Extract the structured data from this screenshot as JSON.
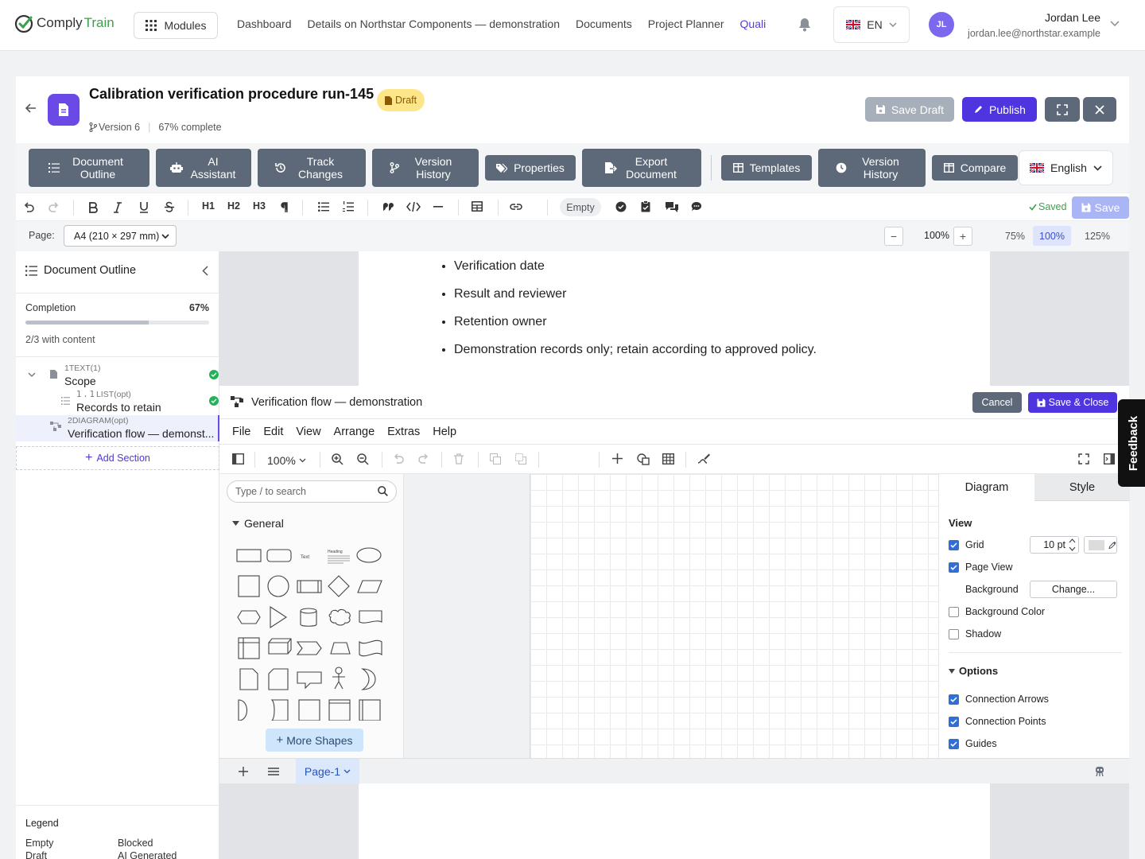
{
  "brand": {
    "part1": "Comply",
    "part2": "Train"
  },
  "nav": {
    "modules": "Modules",
    "links": [
      "Dashboard",
      "Details on Northstar Components — demonstration",
      "Documents",
      "Project Planner",
      "Quali"
    ],
    "lang": "EN",
    "user_initials": "JL",
    "user_name": "Jordan Lee",
    "user_email": "jordan.lee@northstar.example"
  },
  "doc": {
    "title": "Calibration verification procedure run-145",
    "status": "Draft",
    "version": "Version 6",
    "progress_text": "67% complete",
    "save_draft": "Save Draft",
    "publish": "Publish"
  },
  "toolbar": {
    "outline": "Document Outline",
    "ai": "AI Assistant",
    "track": "Track Changes",
    "vhist": "Version History",
    "props": "Properties",
    "export": "Export Document",
    "templates": "Templates",
    "vhist2": "Version History",
    "compare": "Compare",
    "language": "English"
  },
  "format": {
    "h1": "H1",
    "h2": "H2",
    "h3": "H3",
    "status": "Empty",
    "saved": "Saved",
    "save": "Save"
  },
  "page": {
    "label": "Page:",
    "size": "A4 (210 × 297 mm)",
    "zoom": "100%",
    "presets": [
      "75%",
      "100%",
      "125%"
    ],
    "selected_preset": "100%"
  },
  "sidebar": {
    "title": "Document Outline",
    "completion_label": "Completion",
    "completion_value": "67%",
    "completion_fraction": 0.67,
    "with_content": "2/3 with content",
    "items": [
      {
        "num": "1",
        "type": "TEXT(1)",
        "label": "Scope"
      },
      {
        "num": "1.1",
        "type": "LIST(opt)",
        "label": "Records to retain"
      },
      {
        "num": "2",
        "type": "DIAGRAM(opt)",
        "label": "Verification flow — demonst..."
      }
    ],
    "add_section": "Add Section",
    "legend_title": "Legend",
    "legend": [
      "Empty",
      "Blocked",
      "Draft",
      "AI Generated"
    ]
  },
  "content": {
    "bullets": [
      "Verification date",
      "Result and reviewer",
      "Retention owner",
      "Demonstration records only; retain according to approved policy."
    ]
  },
  "diagram": {
    "title": "Verification flow — demonstration",
    "cancel": "Cancel",
    "save_close": "Save & Close",
    "menus": [
      "File",
      "Edit",
      "View",
      "Arrange",
      "Extras",
      "Help"
    ],
    "zoom": "100%",
    "search_placeholder": "Type / to search",
    "general": "General",
    "text_shape": "Text",
    "heading_shape": "Heading",
    "more_shapes": "More Shapes",
    "tabs": [
      "Diagram",
      "Style"
    ],
    "view_label": "View",
    "grid": "Grid",
    "grid_size": "10 pt",
    "page_view": "Page View",
    "background": "Background",
    "change": "Change...",
    "bg_color": "Background Color",
    "shadow": "Shadow",
    "options_label": "Options",
    "conn_arrows": "Connection Arrows",
    "conn_points": "Connection Points",
    "guides": "Guides",
    "page_tab": "Page-1"
  },
  "feedback": "Feedback",
  "colors": {
    "accent": "#4f35e0",
    "toolbar": "#5d6878",
    "success": "#23b25a",
    "draft": "#fde68a"
  }
}
